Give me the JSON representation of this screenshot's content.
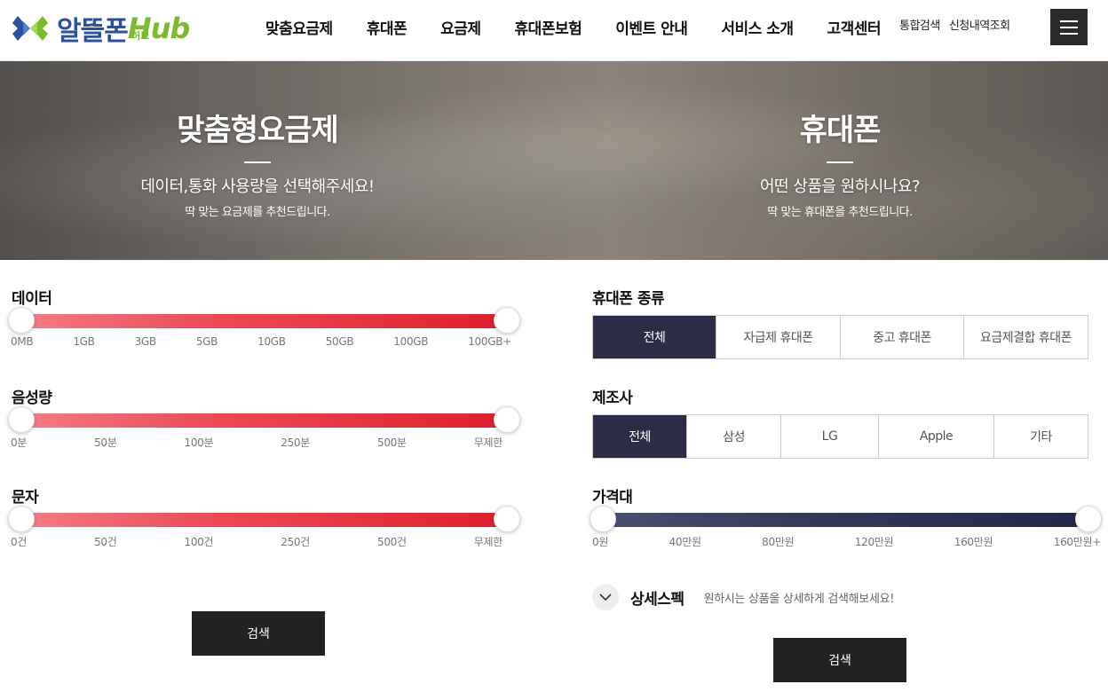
{
  "header": {
    "logo_main": "알뜰폰",
    "logo_hub": "Hub",
    "logo_sub": "허브",
    "nav": [
      "맞춤요금제",
      "휴대폰",
      "요금제",
      "휴대폰보험",
      "이벤트 안내",
      "서비스 소개",
      "고객센터"
    ],
    "util": [
      "통합검색",
      "신청내역조회"
    ]
  },
  "hero": {
    "left": {
      "title": "맞춤형요금제",
      "sub": "데이터,통화 사용량을 선택해주세요!",
      "small": "딱 맞는 요금제를 추천드립니다."
    },
    "right": {
      "title": "휴대폰",
      "sub": "어떤 상품을 원하시나요?",
      "small": "딱 맞는 휴대폰을 추천드립니다."
    }
  },
  "left": {
    "data": {
      "label": "데이터",
      "ticks": [
        "0MB",
        "1GB",
        "3GB",
        "5GB",
        "10GB",
        "50GB",
        "100GB",
        "100GB+"
      ],
      "range": [
        0,
        1
      ]
    },
    "voice": {
      "label": "음성량",
      "ticks": [
        "0분",
        "50분",
        "100분",
        "250분",
        "500분",
        "무제한"
      ],
      "range": [
        0,
        1
      ]
    },
    "sms": {
      "label": "문자",
      "ticks": [
        "0건",
        "50건",
        "100건",
        "250건",
        "500건",
        "무제한"
      ],
      "range": [
        0,
        1
      ]
    },
    "search_label": "검색"
  },
  "right": {
    "type": {
      "label": "휴대폰 종류",
      "options": [
        "전체",
        "자급제 휴대폰",
        "중고 휴대폰",
        "요금제결합 휴대폰"
      ],
      "selected": "전체"
    },
    "maker": {
      "label": "제조사",
      "options": [
        "전체",
        "삼성",
        "LG",
        "Apple",
        "기타"
      ],
      "selected": "전체"
    },
    "price": {
      "label": "가격대",
      "ticks": [
        "0원",
        "40만원",
        "80만원",
        "120만원",
        "160만원",
        "160만원+"
      ],
      "range": [
        0,
        1
      ]
    },
    "detail": {
      "title": "상세스펙",
      "desc": "원하시는 상품을 상세하게 검색해보세요!"
    },
    "search_label": "검색"
  },
  "colors": {
    "accent_red": "#df1f2a",
    "navy": "#2b2d47",
    "logo_blue": "#2b4fa2",
    "logo_green": "#7cbb2a"
  }
}
